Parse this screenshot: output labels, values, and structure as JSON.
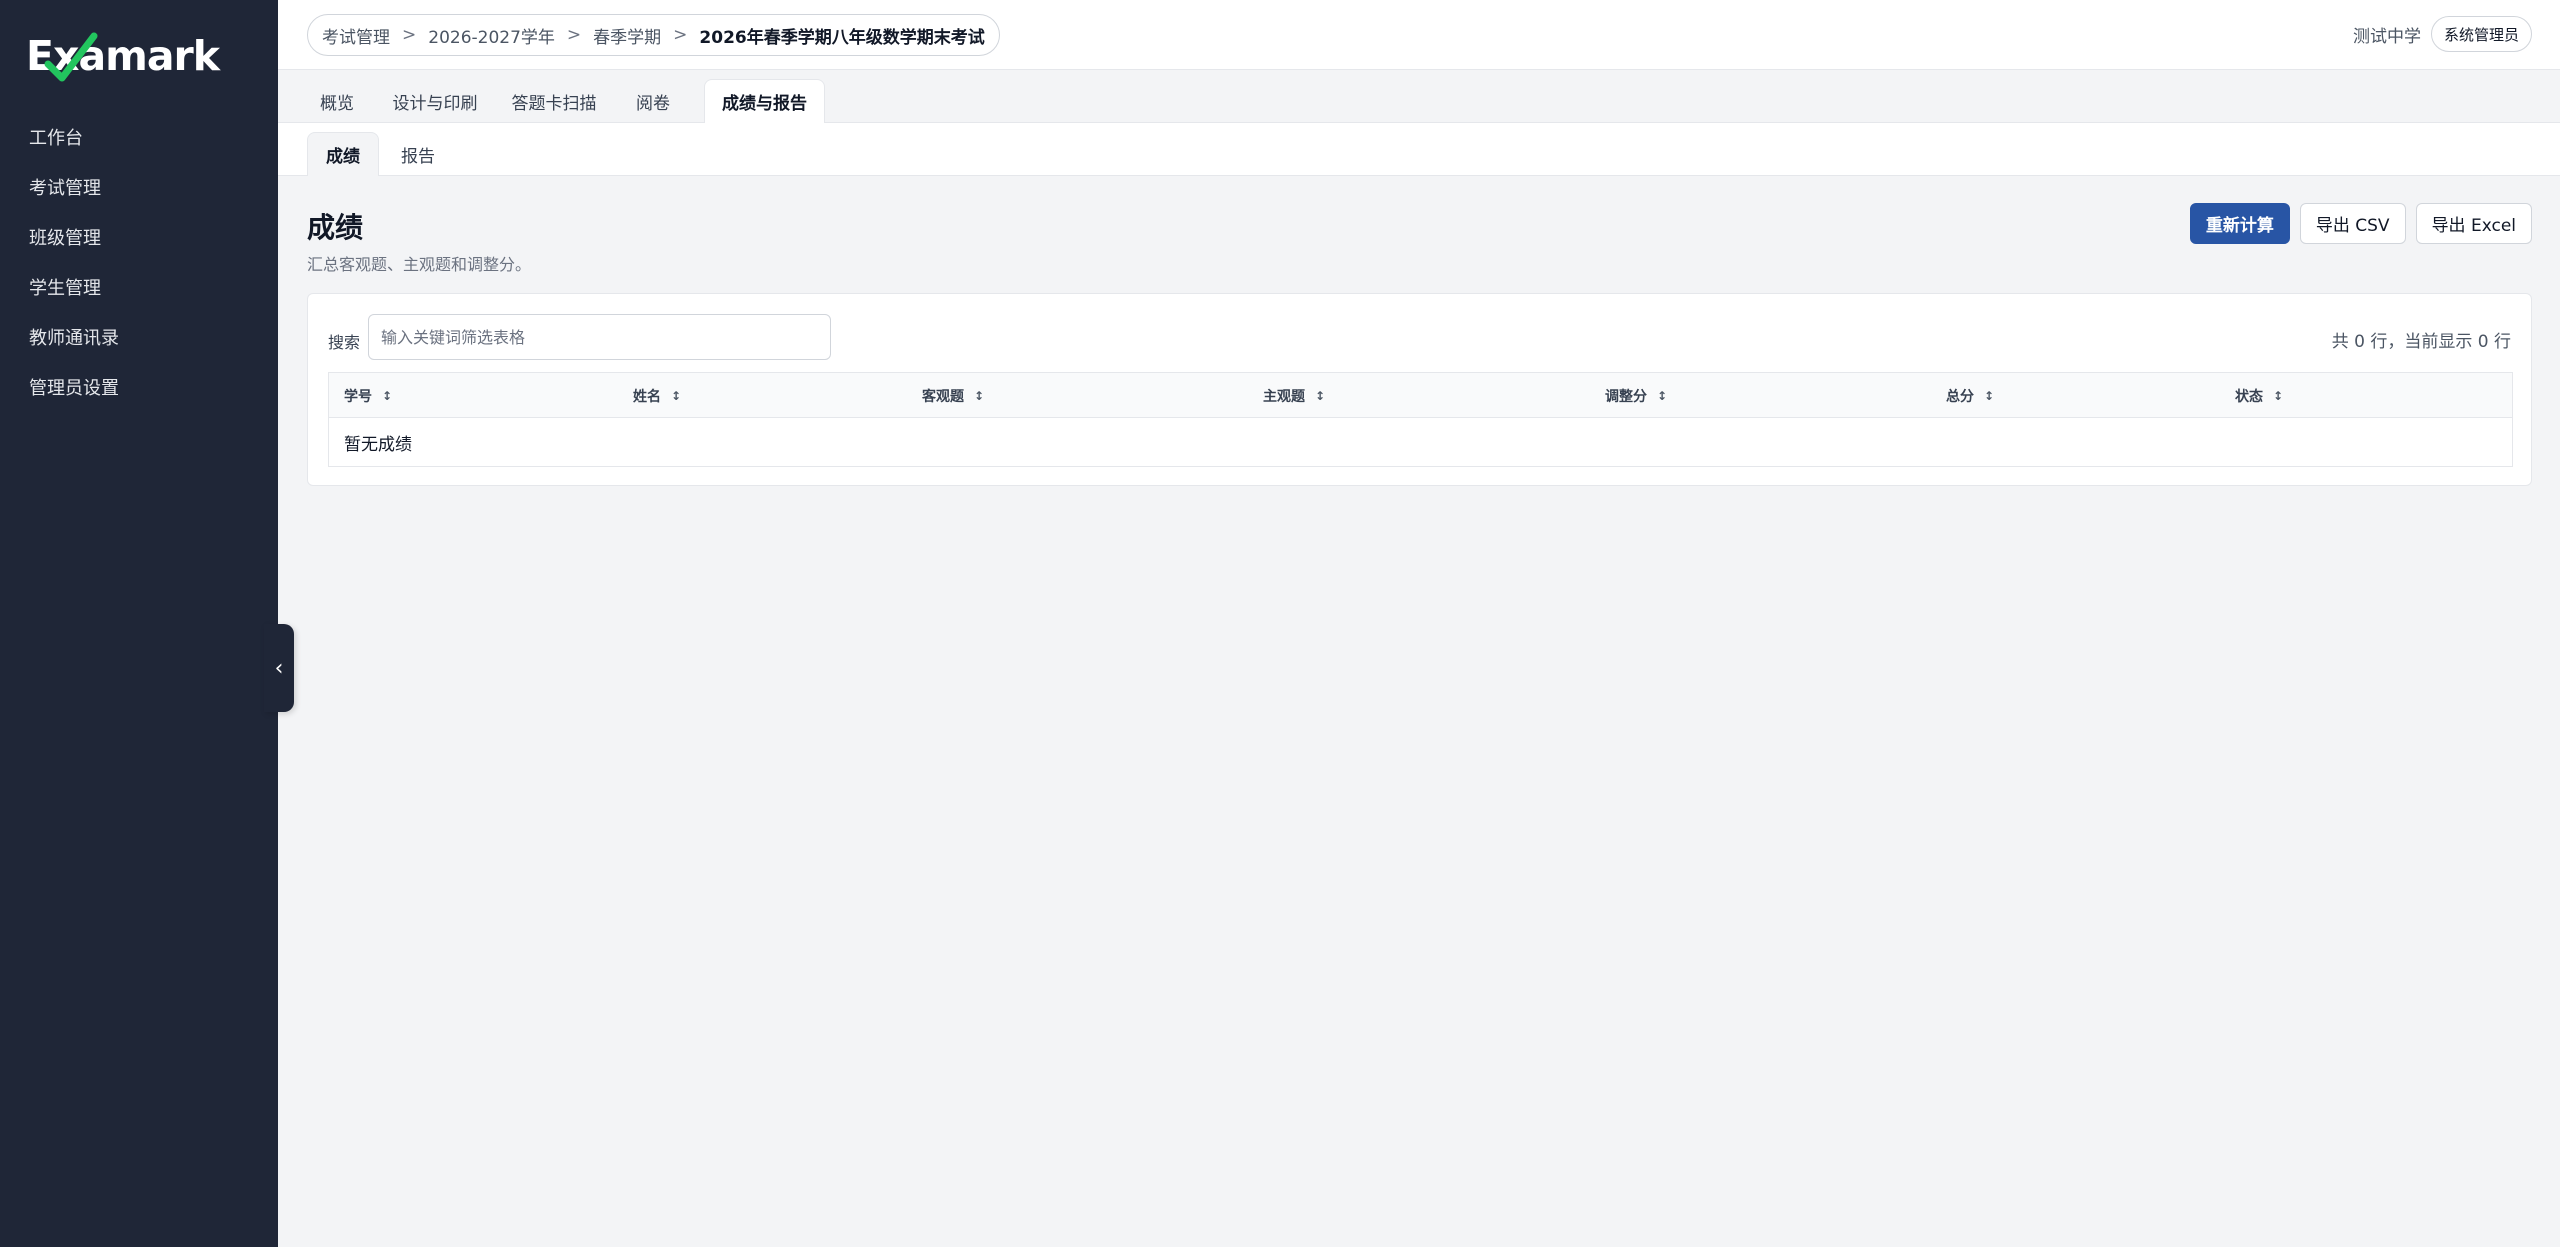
{
  "brand": {
    "logo_text": "Examark"
  },
  "sidebar": {
    "items": [
      {
        "label": "工作台"
      },
      {
        "label": "考试管理"
      },
      {
        "label": "班级管理"
      },
      {
        "label": "学生管理"
      },
      {
        "label": "教师通讯录"
      },
      {
        "label": "管理员设置"
      }
    ],
    "collapse_icon": "chevron-left-icon"
  },
  "header": {
    "breadcrumb": [
      "考试管理",
      "2026-2027学年",
      "春季学期",
      "2026年春季学期八年级数学期末考试"
    ],
    "breadcrumb_separator": ">",
    "school": "测试中学",
    "role": "系统管理员"
  },
  "tabs": [
    {
      "label": "概览"
    },
    {
      "label": "设计与印刷"
    },
    {
      "label": "答题卡扫描"
    },
    {
      "label": "阅卷"
    },
    {
      "label": "成绩与报告",
      "active": true
    }
  ],
  "subtabs": [
    {
      "label": "成绩",
      "active": true
    },
    {
      "label": "报告"
    }
  ],
  "main": {
    "title": "成绩",
    "subtitle": "汇总客观题、主观题和调整分。",
    "actions": {
      "recalculate": "重新计算",
      "export_csv": "导出 CSV",
      "export_excel": "导出 Excel"
    },
    "search": {
      "label": "搜索",
      "value": "",
      "placeholder": "输入关键词筛选表格"
    },
    "row_count": "共 0 行，当前显示 0 行",
    "table": {
      "columns": [
        "学号",
        "姓名",
        "客观题",
        "主观题",
        "调整分",
        "总分",
        "状态"
      ],
      "empty_message": "暂无成绩"
    }
  },
  "colors": {
    "sidebar_bg": "#1f2637",
    "primary": "#2855a5",
    "page_bg": "#f3f4f6",
    "logo_check": "#22c55e"
  }
}
